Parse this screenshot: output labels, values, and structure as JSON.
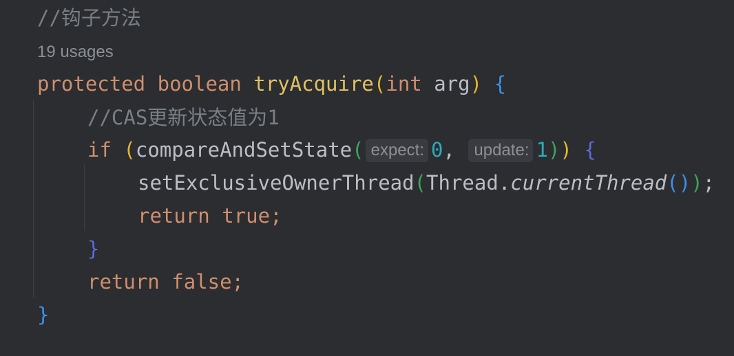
{
  "editor": {
    "comment_hook": "//钩子方法",
    "usages": "19 usages",
    "signature": {
      "modifier": "protected",
      "return_type": "boolean",
      "method_name": "tryAcquire",
      "open_paren": "(",
      "param_type": "int",
      "param_name": "arg",
      "close_paren": ")",
      "open_brace": "{"
    },
    "comment_cas": "//CAS更新状态值为1",
    "if_line": {
      "keyword": "if",
      "open_paren": "(",
      "call": "compareAndSetState",
      "call_open": "(",
      "hint_expect": "expect:",
      "arg_expect": "0",
      "comma": ",",
      "hint_update": "update:",
      "arg_update": "1",
      "call_close": ")",
      "close_paren": ")",
      "open_brace": "{"
    },
    "set_line": {
      "call": "setExclusiveOwnerThread",
      "open_paren": "(",
      "class_name": "Thread",
      "dot": ".",
      "static_call": "currentThread",
      "inner_parens": "()",
      "close_paren": ")",
      "semicolon": ";"
    },
    "return_true": {
      "keyword": "return",
      "value": "true",
      "semicolon": ";"
    },
    "close_if_brace": "}",
    "return_false": {
      "keyword": "return",
      "value": "false",
      "semicolon": ";"
    },
    "close_method_brace": "}"
  },
  "colors": {
    "background": "#2b2d30",
    "keyword": "#cf8e6d",
    "method_declaration": "#e0c262",
    "comment": "#7a7e85",
    "number": "#2aacb8",
    "brace_blue": "#3f8fe8"
  }
}
